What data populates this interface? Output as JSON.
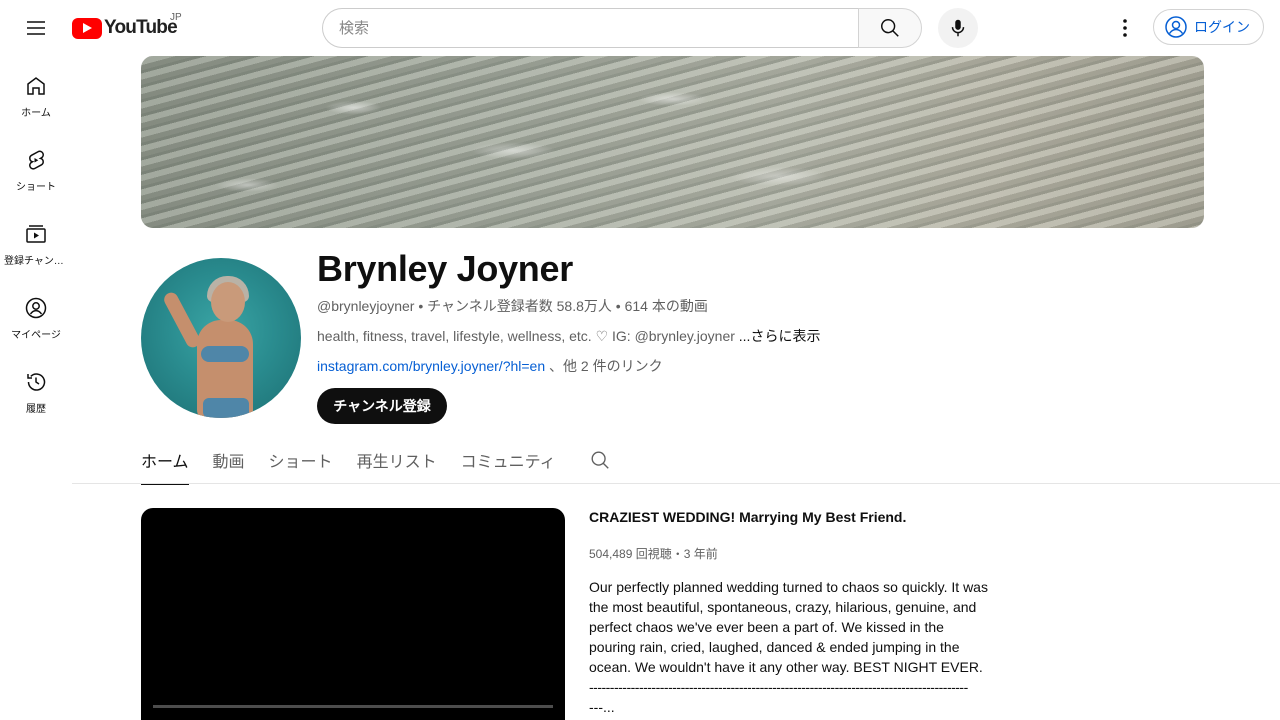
{
  "header": {
    "logo_text": "YouTube",
    "region": "JP",
    "search_placeholder": "検索",
    "login_label": "ログイン"
  },
  "sidebar": {
    "items": [
      {
        "label": "ホーム",
        "icon": "home-icon"
      },
      {
        "label": "ショート",
        "icon": "shorts-icon"
      },
      {
        "label": "登録チャンネル",
        "icon": "subscriptions-icon"
      },
      {
        "label": "マイページ",
        "icon": "you-icon"
      },
      {
        "label": "履歴",
        "icon": "history-icon"
      }
    ]
  },
  "channel": {
    "name": "Brynley Joyner",
    "handle": "@brynleyjoyner",
    "subscribers": "チャンネル登録者数 58.8万人",
    "video_count": "614 本の動画",
    "description": "health, fitness, travel, lifestyle, wellness, etc. ♡ IG: @brynley.joyner",
    "more_label": "...さらに表示",
    "link_url": "instagram.com/brynley.joyner/?hl=en",
    "link_more": "、他 2 件のリンク",
    "subscribe_label": "チャンネル登録"
  },
  "tabs": [
    {
      "label": "ホーム",
      "active": true
    },
    {
      "label": "動画",
      "active": false
    },
    {
      "label": "ショート",
      "active": false
    },
    {
      "label": "再生リスト",
      "active": false
    },
    {
      "label": "コミュニティ",
      "active": false
    }
  ],
  "featured": {
    "title": "CRAZIEST WEDDING! Marrying My Best Friend.",
    "stats": "504,489 回視聴・3 年前",
    "description": "Our perfectly planned wedding turned to chaos so quickly. It was the most beautiful, spontaneous, crazy, hilarious, genuine, and perfect chaos we've ever been a part of. We kissed in the pouring rain, cried, laughed, danced & ended jumping in the ocean. We wouldn't have it any other way. BEST NIGHT EVER.",
    "dashes": "-------------------------------------------------------------------------------------------",
    "dashes_tail": "---..."
  },
  "colors": {
    "brand_red": "#ff0000",
    "link_blue": "#065fd4",
    "text_primary": "#0f0f0f",
    "text_secondary": "#606060"
  }
}
